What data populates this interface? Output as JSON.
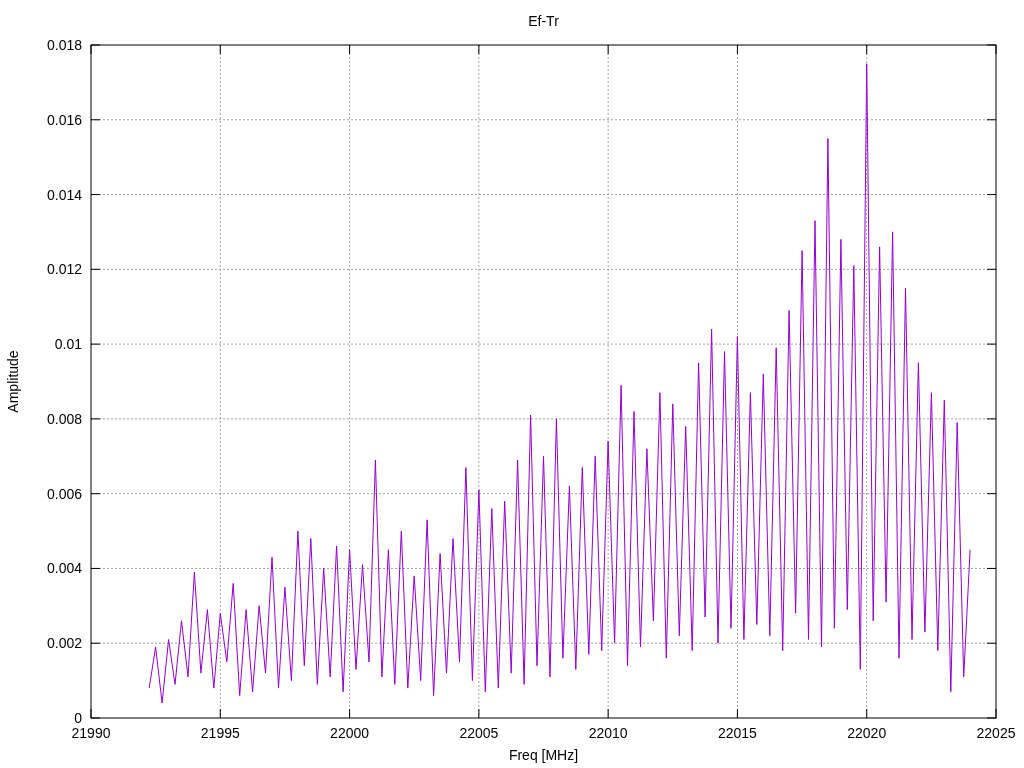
{
  "plot": {
    "chart_data": {
      "type": "line",
      "title": "Ef-Tr",
      "xlabel": "Freq [MHz]",
      "ylabel": "Amplitude",
      "xlim": [
        21990,
        22025
      ],
      "ylim": [
        0,
        0.018
      ],
      "grid": true,
      "xticks": [
        21990,
        21995,
        22000,
        22005,
        22010,
        22015,
        22020,
        22025
      ],
      "yticks": [
        0.018,
        0.016,
        0.014,
        0.012,
        0.01,
        0.008,
        0.006,
        0.004,
        0.002,
        0
      ],
      "x": [
        21992.25,
        21992.5,
        21992.75,
        21993,
        21993.25,
        21993.5,
        21993.75,
        21994,
        21994.25,
        21994.5,
        21994.75,
        21995,
        21995.25,
        21995.5,
        21995.75,
        21996,
        21996.25,
        21996.5,
        21996.75,
        21997,
        21997.25,
        21997.5,
        21997.75,
        21998,
        21998.25,
        21998.5,
        21998.75,
        21999,
        21999.25,
        21999.5,
        21999.75,
        22000,
        22000.25,
        22000.5,
        22000.75,
        22001,
        22001.25,
        22001.5,
        22001.75,
        22002,
        22002.25,
        22002.5,
        22002.75,
        22003,
        22003.25,
        22003.5,
        22003.75,
        22004,
        22004.25,
        22004.5,
        22004.75,
        22005,
        22005.25,
        22005.5,
        22005.75,
        22006,
        22006.25,
        22006.5,
        22006.75,
        22007,
        22007.25,
        22007.5,
        22007.75,
        22008,
        22008.25,
        22008.5,
        22008.75,
        22009,
        22009.25,
        22009.5,
        22009.75,
        22010,
        22010.25,
        22010.5,
        22010.75,
        22011,
        22011.25,
        22011.5,
        22011.75,
        22012,
        22012.25,
        22012.5,
        22012.75,
        22013,
        22013.25,
        22013.5,
        22013.75,
        22014,
        22014.25,
        22014.5,
        22014.75,
        22015,
        22015.25,
        22015.5,
        22015.75,
        22016,
        22016.25,
        22016.5,
        22016.75,
        22017,
        22017.25,
        22017.5,
        22017.75,
        22018,
        22018.25,
        22018.5,
        22018.75,
        22019,
        22019.25,
        22019.5,
        22019.75,
        22020,
        22020.25,
        22020.5,
        22020.75,
        22021,
        22021.25,
        22021.5,
        22021.75,
        22022,
        22022.25,
        22022.5,
        22022.75,
        22023,
        22023.25,
        22023.5,
        22023.75,
        22024
      ],
      "series": [
        {
          "color": "#9400d3",
          "values": [
            0.0008,
            0.0019,
            0.0004,
            0.0021,
            0.0009,
            0.0026,
            0.0011,
            0.0039,
            0.0012,
            0.0029,
            0.0008,
            0.0028,
            0.0015,
            0.0036,
            0.0006,
            0.0029,
            0.0007,
            0.003,
            0.0012,
            0.0043,
            0.0008,
            0.0035,
            0.001,
            0.005,
            0.0014,
            0.0048,
            0.0009,
            0.004,
            0.0011,
            0.0046,
            0.0007,
            0.0045,
            0.0013,
            0.0041,
            0.0015,
            0.0069,
            0.0011,
            0.0045,
            0.0009,
            0.005,
            0.0008,
            0.0038,
            0.001,
            0.0053,
            0.0006,
            0.0044,
            0.0012,
            0.0048,
            0.0015,
            0.0067,
            0.001,
            0.0061,
            0.0007,
            0.0056,
            0.0008,
            0.0058,
            0.0012,
            0.0069,
            0.0009,
            0.0081,
            0.0014,
            0.007,
            0.0011,
            0.008,
            0.0016,
            0.0062,
            0.0013,
            0.0067,
            0.0017,
            0.007,
            0.0018,
            0.0074,
            0.002,
            0.0089,
            0.0014,
            0.0082,
            0.0019,
            0.0072,
            0.0026,
            0.0087,
            0.0016,
            0.0084,
            0.0022,
            0.0078,
            0.0018,
            0.0095,
            0.0027,
            0.0104,
            0.002,
            0.0098,
            0.0024,
            0.0102,
            0.0021,
            0.0087,
            0.0025,
            0.0092,
            0.0022,
            0.0099,
            0.0018,
            0.0109,
            0.0028,
            0.0125,
            0.0021,
            0.0133,
            0.0019,
            0.0155,
            0.0024,
            0.0128,
            0.0029,
            0.0121,
            0.0013,
            0.0175,
            0.0026,
            0.0126,
            0.0031,
            0.013,
            0.0016,
            0.0115,
            0.0021,
            0.0095,
            0.0023,
            0.0087,
            0.0018,
            0.0085,
            0.0007,
            0.0079,
            0.0011,
            0.0045
          ]
        }
      ]
    }
  }
}
